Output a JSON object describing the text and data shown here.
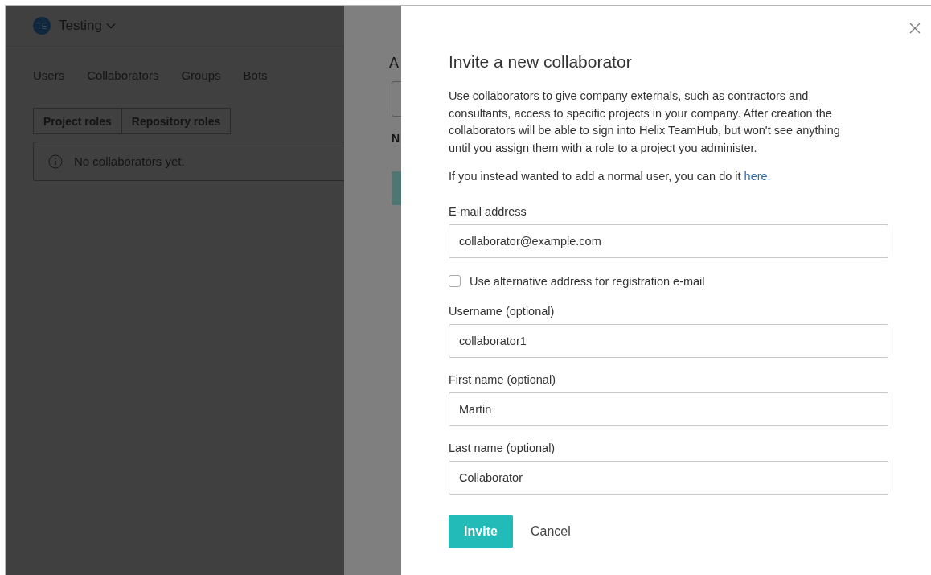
{
  "header": {
    "avatar": "TE",
    "title": "Testing"
  },
  "nav": [
    {
      "label": "Users"
    },
    {
      "label": "Collaborators"
    },
    {
      "label": "Groups"
    },
    {
      "label": "Bots"
    }
  ],
  "role_tabs": [
    {
      "label": "Project roles"
    },
    {
      "label": "Repository roles"
    }
  ],
  "notice": "No collaborators yet.",
  "behind_panel": {
    "heading": "A",
    "label": "N"
  },
  "dialog": {
    "title": "Invite a new collaborator",
    "description": "Use collaborators to give company externals, such as contractors and consultants, access to specific projects in your company. After creation the collaborators will be able to sign into Helix TeamHub, but won't see anything until you assign them with a role to a project you administer.",
    "hint": "If you instead wanted to add a normal user, you can do it",
    "hint_link": "here.",
    "email": {
      "label": "E-mail address",
      "value": "collaborator@example.com"
    },
    "alt_address": {
      "label": "Use alternative address for registration e-mail",
      "checked": false
    },
    "fields": [
      {
        "label": "Username (optional)",
        "value": "collaborator1"
      },
      {
        "label": "First name (optional)",
        "value": "Martin"
      },
      {
        "label": "Last name (optional)",
        "value": "Collaborator"
      }
    ],
    "buttons": {
      "primary": "Invite",
      "secondary": "Cancel"
    }
  }
}
